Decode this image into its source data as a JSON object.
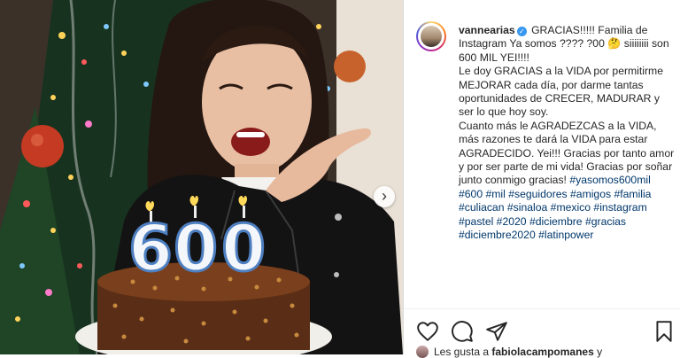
{
  "post": {
    "username": "vannearias",
    "caption_text": " GRACIAS!!!!! Familia de Instagram Ya somos ???? ?00 🤔 siiiiiiii son 600 MIL YEI!!!!\nLe doy GRACIAS a la VIDA por permitirme MEJORAR cada día, por darme tantas oportunidades de CRECER, MADURAR y ser lo que hoy soy.\nCuanto más le AGRADEZCAS a la VIDA, más razones te dará la VIDA para estar AGRADECIDO. Yei!!! Gracias por tanto amor y por ser parte de mi vida! Gracias por soñar junto conmigo gracias! ",
    "hashtags": "#yasomos600mil #600 #mil #seguidores #amigos #familia #culiacan #sinaloa #mexico #instagram #pastel #2020 #diciembre #gracias #diciembre2020 #latinpower",
    "likes_prefix": "Les gusta a ",
    "likes_user": "fabiolacampomanes",
    "likes_suffix": " y"
  },
  "photo": {
    "candle_digits": [
      "6",
      "0",
      "0"
    ]
  },
  "colors": {
    "link": "#00376b",
    "verified": "#3897f0",
    "text": "#262626"
  },
  "icons": {
    "like": "heart-icon",
    "comment": "comment-icon",
    "share": "share-icon",
    "save": "bookmark-icon",
    "next": "chevron-right-icon"
  }
}
